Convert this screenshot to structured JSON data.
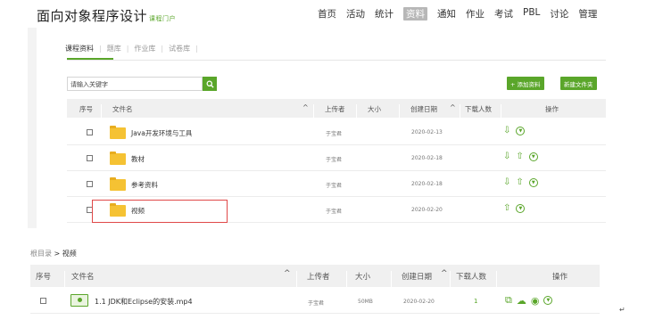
{
  "header": {
    "course_title": "面向对象程序设计",
    "portal_link": "课程门户",
    "nav": [
      "首页",
      "活动",
      "统计",
      "资料",
      "通知",
      "作业",
      "考试",
      "PBL",
      "讨论",
      "管理"
    ],
    "active_nav": "资料"
  },
  "subtabs": [
    "课程资料",
    "题库",
    "作业库",
    "试卷库"
  ],
  "search": {
    "value": "请输入关键字"
  },
  "buttons": {
    "add_material": "+ 添加资料",
    "new_folder": "新建文件夹"
  },
  "table": {
    "headers": {
      "index": "序号",
      "filename": "文件名",
      "uploader": "上传者",
      "size": "大小",
      "created": "创建日期",
      "downloads": "下载人数",
      "ops": "操作"
    },
    "rows": [
      {
        "name": "Java开发环境与工具",
        "uploader": "于宝君",
        "date": "2020-02-13"
      },
      {
        "name": "教材",
        "uploader": "于宝君",
        "date": "2020-02-18"
      },
      {
        "name": "参考资料",
        "uploader": "于宝君",
        "date": "2020-02-18"
      },
      {
        "name": "视频",
        "uploader": "于宝君",
        "date": "2020-02-20"
      }
    ]
  },
  "lower": {
    "breadcrumb_root": "根目录",
    "breadcrumb_sep": " > ",
    "breadcrumb_current": "视频",
    "headers": {
      "index": "序号",
      "filename": "文件名",
      "uploader": "上传者",
      "size": "大小",
      "created": "创建日期",
      "downloads": "下载人数",
      "ops": "操作"
    },
    "file": {
      "name": "1.1 JDK和Eclipse的安装.mp4",
      "uploader": "于宝君",
      "size": "50MB",
      "date": "2020-02-20",
      "downloads": "1"
    }
  },
  "colors": {
    "accent": "#5aa62a",
    "highlight_border": "#e04848"
  },
  "misc": {
    "return_mark": "↵"
  }
}
